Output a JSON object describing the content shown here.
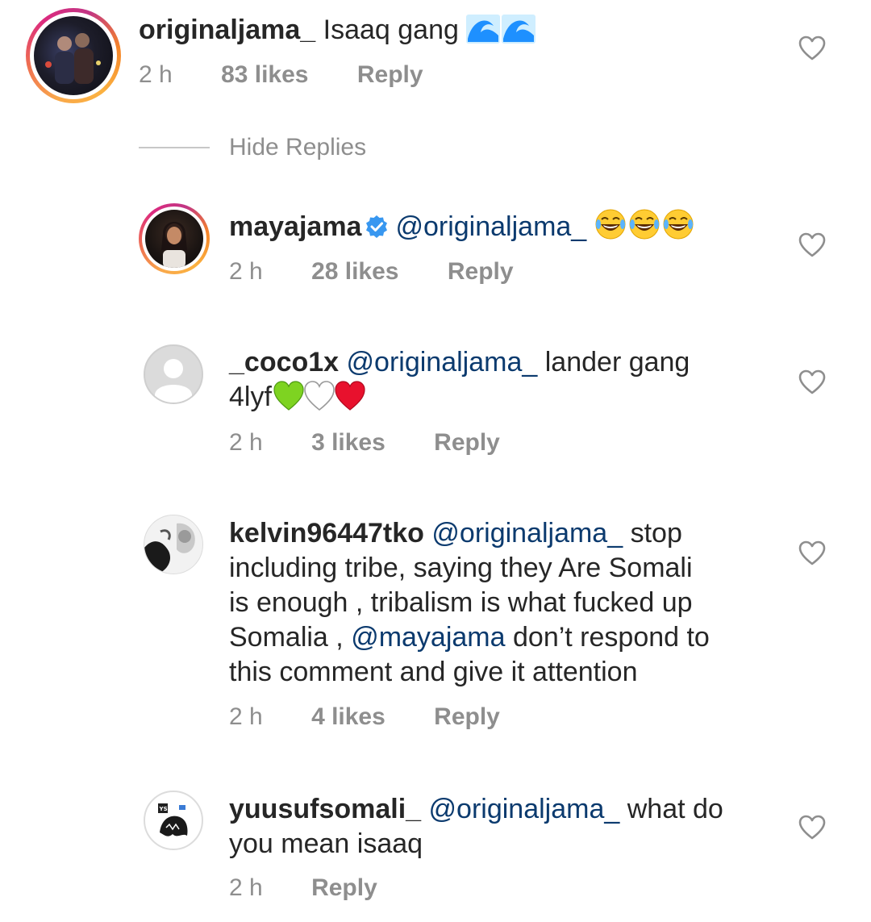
{
  "comments": [
    {
      "username": "originaljama_",
      "text": "Isaaq gang",
      "emoji": "wave-emoji x2",
      "time": "2 h",
      "likes": "83 likes",
      "reply": "Reply"
    },
    {
      "username": "mayajama",
      "verified": true,
      "mention": "@originaljama_",
      "emoji": "joy-emoji x3",
      "time": "2 h",
      "likes": "28 likes",
      "reply": "Reply"
    },
    {
      "username": "_coco1x",
      "mention": "@originaljama_",
      "text": "lander gang",
      "text2": "4lyf",
      "emoji": "green-white-red-hearts",
      "time": "2 h",
      "likes": "3 likes",
      "reply": "Reply"
    },
    {
      "username": "kelvin96447tko",
      "mention": "@originaljama_",
      "text_a": "stop",
      "text_b": "including tribe, saying they Are Somali",
      "text_c": "is enough , tribalism is what fucked up",
      "text_d": "Somalia ,",
      "mention2": "@mayajama",
      "text_e": "don’t respond to",
      "text_f": "this comment and give it attention",
      "time": "2 h",
      "likes": "4 likes",
      "reply": "Reply"
    },
    {
      "username": "yuusufsomali_",
      "mention": "@originaljama_",
      "text": "what do",
      "text2": "you mean isaaq",
      "time": "2 h",
      "reply": "Reply"
    }
  ],
  "hide_replies": "Hide Replies",
  "colors": {
    "text": "#262626",
    "meta": "#8e8e8e",
    "mention": "#0b3a6e",
    "verified": "#3897f0",
    "heart_outline": "#8e8e8e"
  },
  "icons": [
    "heart-outline-icon",
    "verified-badge-icon",
    "default-avatar-icon"
  ]
}
